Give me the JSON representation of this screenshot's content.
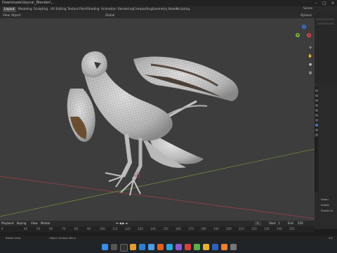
{
  "window": {
    "title": "Downloads\\Vayna\\_Blender\\..."
  },
  "workspace_tabs": [
    "Layout",
    "Modeling",
    "Sculpting",
    "UV Editing",
    "Texture Paint",
    "Shading",
    "Animation",
    "Rendering",
    "Compositing",
    "Geometry Nodes",
    "Scripting"
  ],
  "scene_label": "Scene",
  "viewport_header": {
    "mode": "Object Mode",
    "view": "View",
    "object": "Object",
    "orientation": "Global",
    "options": "Options"
  },
  "gizmo": {
    "x": "X",
    "y": "Y",
    "z": "Z"
  },
  "timeline": {
    "menus": [
      "Playback",
      "Keying",
      "View",
      "Marker"
    ],
    "start_label": "Start",
    "start": "1",
    "end_label": "End",
    "end": "250",
    "current_frame": "1",
    "ticks": [
      "0",
      "40",
      "50",
      "60",
      "70",
      "80",
      "90",
      "100",
      "110",
      "120",
      "130",
      "140",
      "150",
      "160",
      "170",
      "180",
      "190",
      "200",
      "210",
      "220",
      "230",
      "240",
      "250"
    ]
  },
  "status": {
    "left": "Rotate View",
    "mid": "Object Context Menu",
    "right": "3.6"
  },
  "properties": {
    "labels": [
      "Subsu",
      "Subdiv",
      "Subdiv Le"
    ]
  },
  "colors": {
    "viewport_bg": "#3d3d3d",
    "mesh": "#cfcfcf",
    "active_tab": "#4a4a4a",
    "x_axis": "#e8484f",
    "y_axis": "#7bb33c",
    "z_axis": "#3b7be0"
  }
}
